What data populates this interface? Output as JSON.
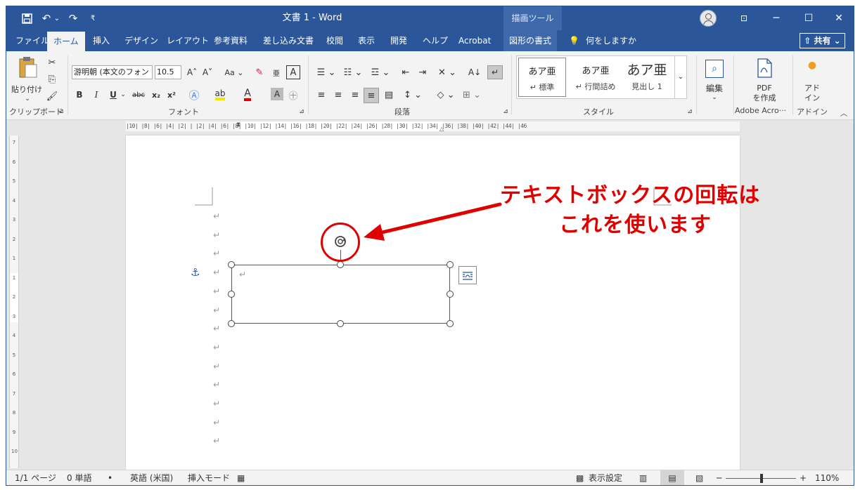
{
  "window": {
    "title": "文書 1  -  Word",
    "context_tool": "描画ツール",
    "controls": {
      "minimize": "─",
      "restore": "☐",
      "close": "✕",
      "ribbon_display": "⊡"
    }
  },
  "quick_access": {
    "save": "🖫",
    "undo": "↶",
    "undo_more": "⌄",
    "redo": "↷",
    "customize": "₹"
  },
  "tabs": [
    "ファイル",
    "ホーム",
    "挿入",
    "デザイン",
    "レイアウト",
    "参考資料",
    "差し込み文書",
    "校閲",
    "表示",
    "開発",
    "ヘルプ",
    "Acrobat"
  ],
  "active_tab": "ホーム",
  "context_tab": "図形の書式",
  "tell_me": "何をしますか",
  "share": "⇧ 共有 ⌄",
  "ribbon": {
    "clipboard": {
      "paste": "貼り付け",
      "label": "クリップボード"
    },
    "font": {
      "font_name": "游明朝 (本文のフォン",
      "font_size": "10.5",
      "grow": "A˄",
      "shrink": "A˅",
      "case": "Aa ⌄",
      "bold": "B",
      "italic": "I",
      "underline": "U",
      "strike": "abc",
      "subscript": "x₂",
      "superscript": "x²",
      "label": "フォント"
    },
    "paragraph": {
      "label": "段落"
    },
    "styles": {
      "items": [
        {
          "preview": "あア亜",
          "name": "↵ 標準"
        },
        {
          "preview": "あア亜",
          "name": "↵ 行間詰め"
        },
        {
          "preview": "あア亜",
          "name": "見出し 1"
        }
      ],
      "label": "スタイル"
    },
    "editing": {
      "label": "編集"
    },
    "adobe": {
      "button": "PDF\nを作成",
      "label": "Adobe Acro···"
    },
    "addin": {
      "button": "アド\nイン",
      "label": "アドイン"
    }
  },
  "ruler": {
    "corner": "L",
    "horizontal": "|10| |8| |6| |4| |2| | |2| |4| |6| |8| |10| |12| |14| |16| |18| |20| |22| |24| |26| |28| |30| |32| |34| |36| |38| |40| |42| |44| |46",
    "vertical": [
      "7",
      "6",
      "5",
      "4",
      "3",
      "2",
      "1",
      "1",
      "2",
      "3",
      "4",
      "5",
      "6",
      "7",
      "8",
      "9",
      "10"
    ]
  },
  "document": {
    "paragraph_mark": "↵",
    "anchor": "⚓"
  },
  "annotation": {
    "line1": "テキストボックスの回転は",
    "line2": "これを使います",
    "color": "#e00000"
  },
  "status": {
    "page": "1/1 ページ",
    "words": "0 単語",
    "language": "英語 (米国)",
    "mode": "挿入モード",
    "display_settings": "表示設定",
    "zoom_minus": "─",
    "zoom_plus": "+",
    "zoom": "110%"
  },
  "colors": {
    "brand": "#2b579a",
    "annotation": "#e00000",
    "ribbon_bg": "#f3f3f3"
  }
}
